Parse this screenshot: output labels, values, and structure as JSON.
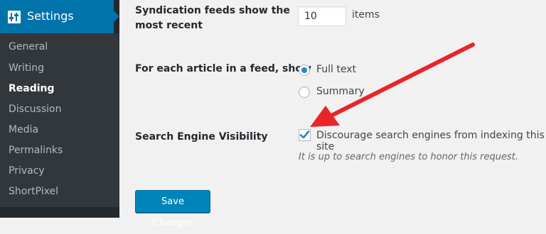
{
  "sidebar": {
    "header_label": "Settings",
    "items": [
      {
        "label": "General"
      },
      {
        "label": "Writing"
      },
      {
        "label": "Reading"
      },
      {
        "label": "Discussion"
      },
      {
        "label": "Media"
      },
      {
        "label": "Permalinks"
      },
      {
        "label": "Privacy"
      },
      {
        "label": "ShortPixel"
      }
    ],
    "current": "Reading"
  },
  "syndication": {
    "label_line1": "Syndication feeds show the",
    "label_line2": "most recent",
    "value": "10",
    "unit": "items"
  },
  "feed_article": {
    "label": "For each article in a feed, show",
    "options": [
      {
        "label": "Full text",
        "selected": true
      },
      {
        "label": "Summary",
        "selected": false
      }
    ]
  },
  "search_visibility": {
    "label": "Search Engine Visibility",
    "checkbox_label": "Discourage search engines from indexing this site",
    "checked": true,
    "description": "It is up to search engines to honor this request."
  },
  "save_button_label": "Save Changes",
  "colors": {
    "accent": "#0073aa",
    "arrow": "#e8252a",
    "sidebar_bg": "#23282d"
  }
}
